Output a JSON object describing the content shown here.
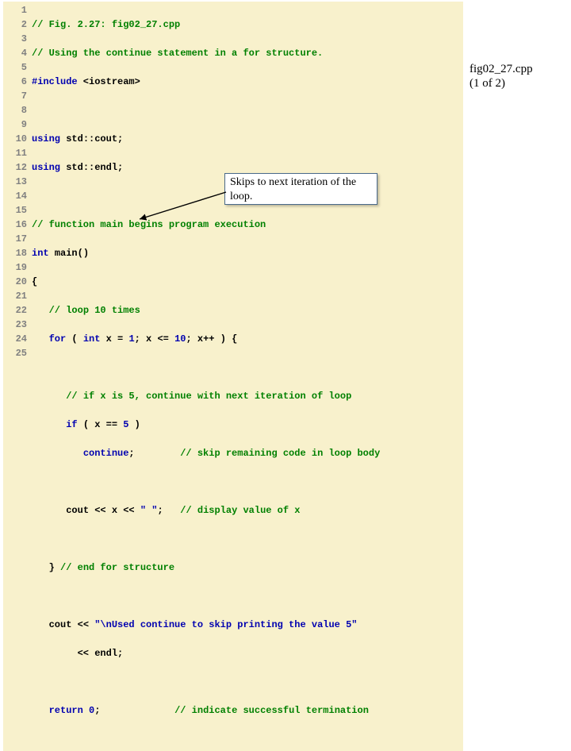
{
  "sidecap": {
    "line1": "fig02_27.cpp",
    "line2": "(1 of 2)"
  },
  "callout": {
    "text": "Skips to next iteration of the loop."
  },
  "code": {
    "line_count": 25,
    "lines": {
      "1": {
        "cmt": "// Fig. 2.27: fig02_27.cpp"
      },
      "2": {
        "cmt": "// Using the continue statement in a for structure."
      },
      "3": {
        "pp_kw": "#include",
        "pp_rest": " <iostream>"
      },
      "5": {
        "kw": "using",
        "rest": " std::cout;"
      },
      "6": {
        "kw": "using",
        "rest": " std::endl;"
      },
      "8": {
        "cmt": "// function main begins program execution"
      },
      "9": {
        "kw": "int",
        "rest": " main()"
      },
      "10": {
        "rest": "{"
      },
      "11": {
        "indent": "   ",
        "cmt": "// loop 10 times"
      },
      "12": {
        "indent": "   ",
        "a": "for",
        "b": " ( ",
        "c": "int",
        "d": " x = ",
        "e": "1",
        "f": "; x <= ",
        "g": "10",
        "h": "; x++ ) {"
      },
      "14": {
        "indent": "      ",
        "cmt": "// if x is 5, continue with next iteration of loop"
      },
      "15": {
        "indent": "      ",
        "a": "if",
        "b": " ( x == ",
        "c": "5",
        "d": " )"
      },
      "16": {
        "indent": "         ",
        "a": "continue",
        "b": ";        ",
        "cmt": "// skip remaining code in loop body"
      },
      "18": {
        "indent": "      ",
        "a": "cout << x << ",
        "str": "\" \"",
        "b": ";   ",
        "cmt": "// display value of x"
      },
      "20": {
        "indent": "   ",
        "a": "} ",
        "cmt": "// end for structure"
      },
      "22": {
        "indent": "   ",
        "a": "cout << ",
        "str": "\"\\nUsed continue to skip printing the value 5\""
      },
      "23": {
        "indent": "        ",
        "a": "<< endl;"
      },
      "25": {
        "indent": "   ",
        "a": "return",
        "b": " ",
        "c": "0",
        "d": ";             ",
        "cmt": "// indicate successful termination"
      }
    }
  }
}
